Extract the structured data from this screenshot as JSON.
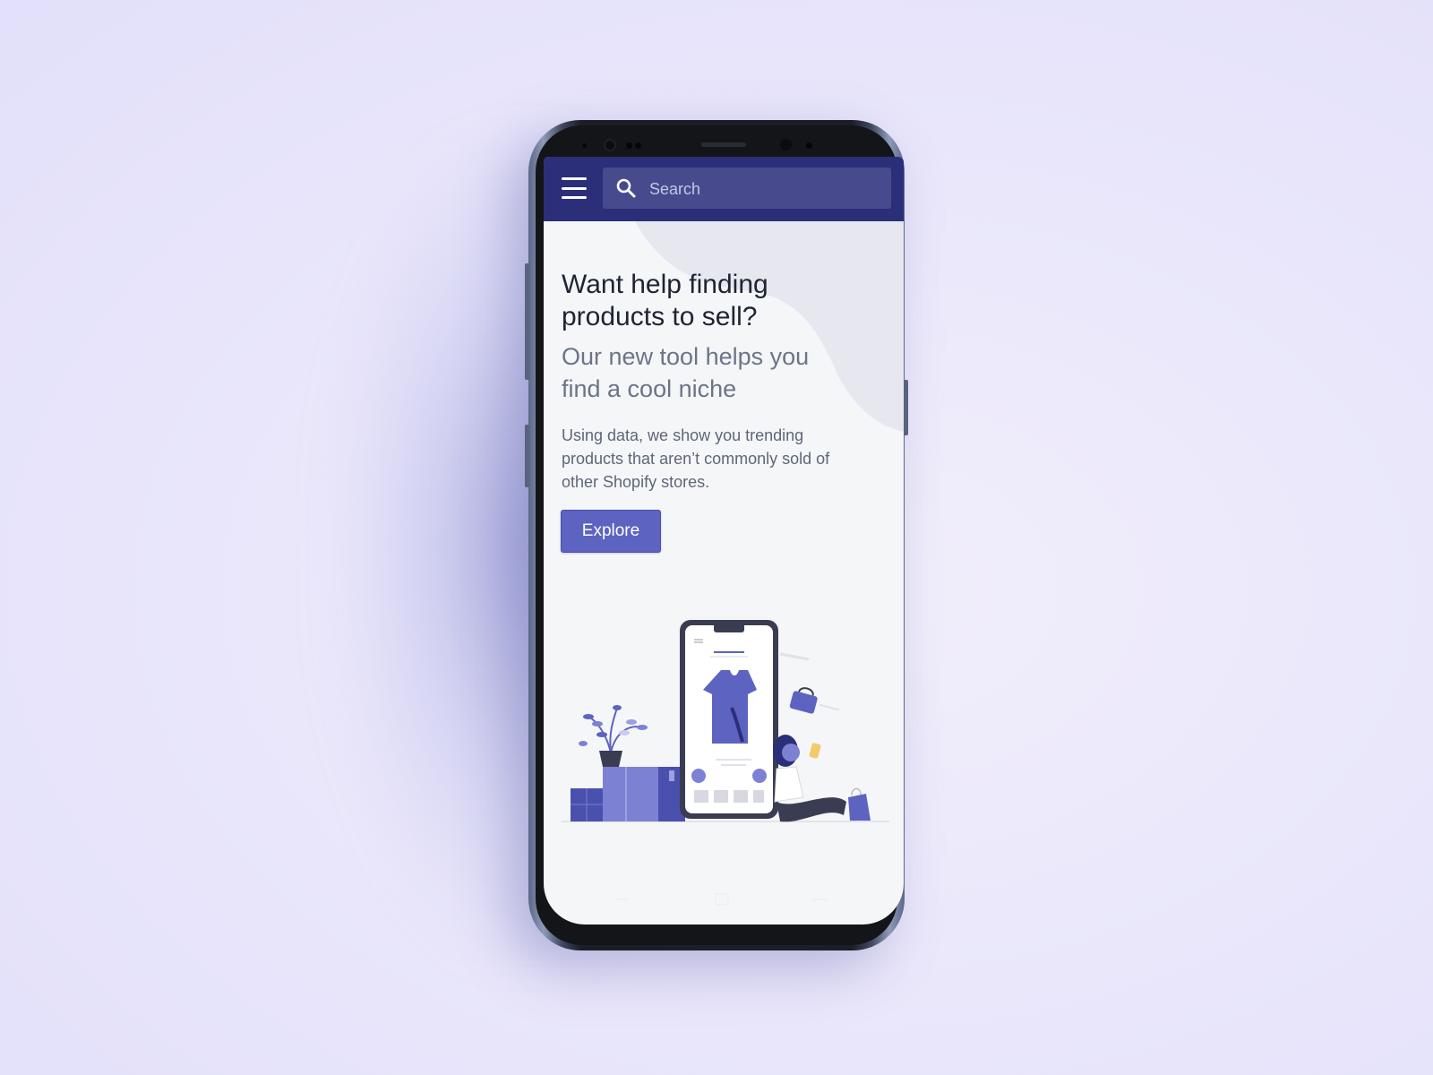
{
  "header": {
    "search": {
      "placeholder": "Search"
    }
  },
  "hero": {
    "headline": "Want help finding products to sell?",
    "subheadline": "Our new tool helps you find a cool niche",
    "body": "Using data, we show you trending products that aren’t commonly sold of other Shopify stores.",
    "cta_label": "Explore"
  },
  "colors": {
    "page_background": "#e9e6fb",
    "header_background": "#2b2f79",
    "search_background": "#474b8d",
    "screen_background": "#f5f6f8",
    "accent": "#5c63c1",
    "headline_text": "#1e2433",
    "muted_text": "#6b7488"
  },
  "icons": {
    "menu": "hamburger-icon",
    "search": "search-icon"
  }
}
